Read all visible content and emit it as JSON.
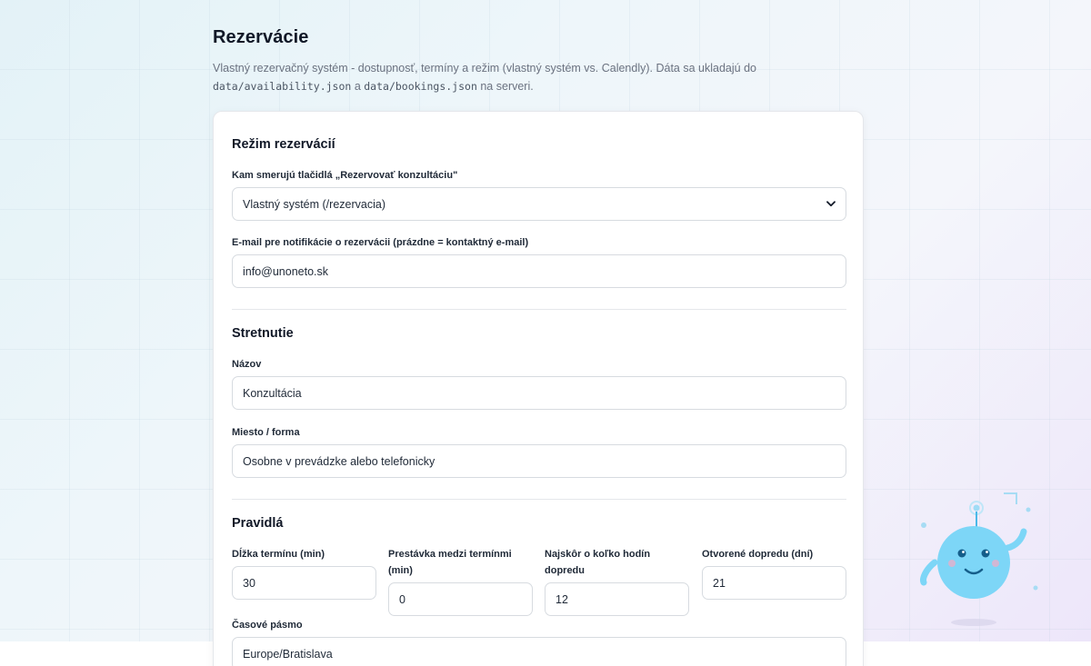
{
  "header": {
    "title": "Rezervácie",
    "desc_pre": "Vlastný rezervačný systém - dostupnosť, termíny a režim (vlastný systém vs. Calendly). Dáta sa ukladajú do",
    "desc_code1": "data/availability.json",
    "desc_mid": "a",
    "desc_code2": "data/bookings.json",
    "desc_post": "na serveri."
  },
  "mode": {
    "title": "Režim rezervácií",
    "target_label": "Kam smerujú tlačidlá „Rezervovať konzultáciu\"",
    "target_value": "Vlastný systém (/rezervacia)",
    "email_label": "E-mail pre notifikácie o rezervácii (prázdne = kontaktný e-mail)",
    "email_value": "info@unoneto.sk"
  },
  "meeting": {
    "title": "Stretnutie",
    "name_label": "Názov",
    "name_value": "Konzultácia",
    "place_label": "Miesto / forma",
    "place_value": "Osobne v prevádzke alebo telefonicky"
  },
  "rules": {
    "title": "Pravidlá",
    "duration_label": "Dĺžka termínu (min)",
    "duration_value": "30",
    "break_label": "Prestávka medzi termínmi (min)",
    "break_value": "0",
    "lead_label": "Najskôr o koľko hodín dopredu",
    "lead_value": "12",
    "ahead_label": "Otvorené dopredu (dní)",
    "ahead_value": "21",
    "tz_label": "Časové pásmo",
    "tz_value": "Europe/Bratislava"
  },
  "icons": {
    "select_chevron": "chevron-down-icon",
    "mascot": "robot-mascot"
  },
  "colors": {
    "robot_body": "#7dd6f7",
    "robot_accent": "#4bb8e8"
  }
}
